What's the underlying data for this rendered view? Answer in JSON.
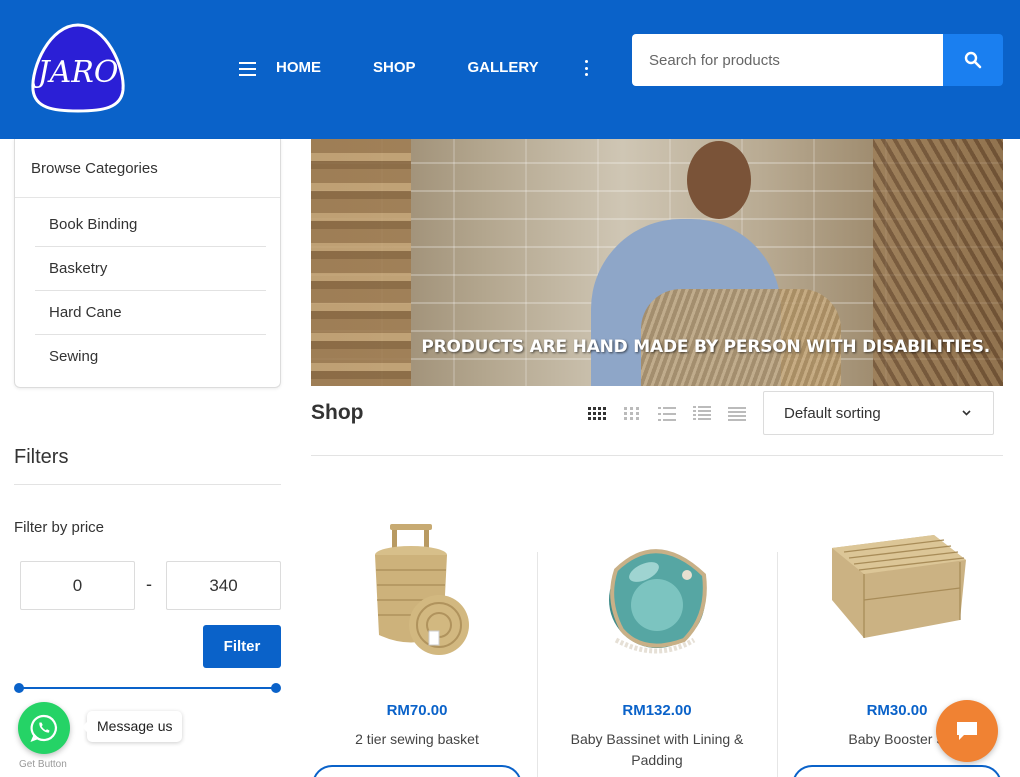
{
  "header": {
    "logo_text": "JARO",
    "nav": [
      {
        "label": "HOME"
      },
      {
        "label": "SHOP"
      },
      {
        "label": "GALLERY"
      }
    ],
    "search_placeholder": "Search for products",
    "colors": {
      "bar": "#0a62c9",
      "search_button": "#1a7ff0"
    }
  },
  "sidebar": {
    "categories_title": "Browse Categories",
    "categories": [
      {
        "label": "Book Binding"
      },
      {
        "label": "Basketry"
      },
      {
        "label": "Hard Cane"
      },
      {
        "label": "Sewing"
      }
    ],
    "filters_title": "Filters",
    "price_filter_title": "Filter by price",
    "price_min": "0",
    "price_max": "340",
    "price_dash": "-",
    "filter_button": "Filter",
    "slider_range": {
      "min_fraction": 0.0,
      "max_fraction": 1.0
    }
  },
  "banner": {
    "caption": "PRODUCTS ARE HAND MADE BY PERSON WITH DISABILITIES."
  },
  "shop": {
    "title": "Shop",
    "view_icons": [
      "grid-4-icon",
      "grid-3-icon",
      "list-icon",
      "numbered-list-icon",
      "rows-icon"
    ],
    "sorting": "Default sorting",
    "products": [
      {
        "price": "RM70.00",
        "name": "2 tier sewing basket"
      },
      {
        "price": "RM132.00",
        "name": "Baby Bassinet with Lining & Padding"
      },
      {
        "price": "RM30.00",
        "name": "Baby Booster S"
      }
    ]
  },
  "whatsapp": {
    "label": "Message us",
    "credit": "Get Button",
    "color": "#25d366"
  },
  "chat": {
    "color": "#f08233"
  }
}
